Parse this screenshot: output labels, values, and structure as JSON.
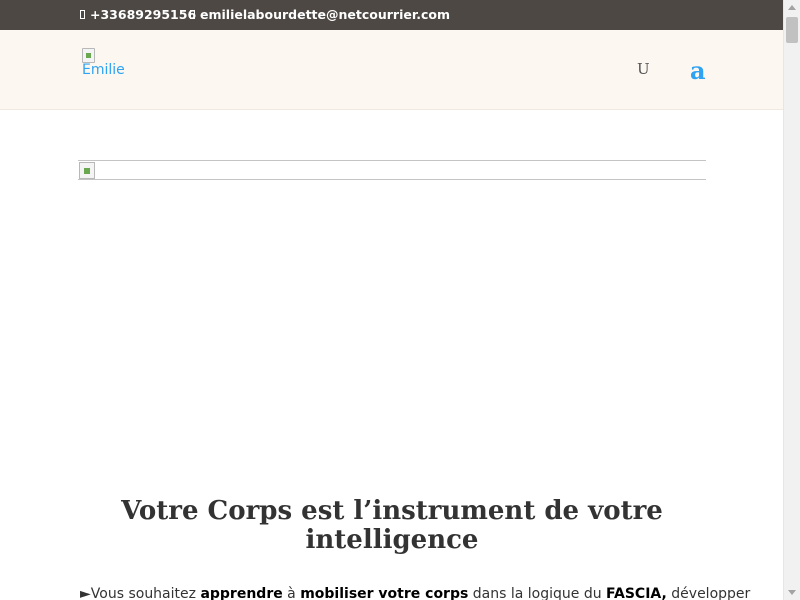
{
  "topbar": {
    "phone": "+33689295156",
    "email": "emilielabourdette@netcourrier.com",
    "icons": [
      "phone-icon",
      "envelope-icon"
    ],
    "background": "#4d4843"
  },
  "header": {
    "logo_alt": "Emilie",
    "nav_item_1": "U",
    "nav_item_2": "a",
    "background": "#fcf7f1",
    "accent": "#2ea3f2"
  },
  "hero": {
    "headline": "Votre Corps est l’instrument de votre intelligence"
  },
  "intro": {
    "bullet": "►",
    "t1": "Vous souhaitez ",
    "b1": "apprendre",
    "t2": " à ",
    "b2": "mobiliser votre corps",
    "t3": " dans la logique du ",
    "b3": "FASCIA,",
    "t4": "  développer"
  },
  "scrollbar": {
    "position": 0.0
  }
}
